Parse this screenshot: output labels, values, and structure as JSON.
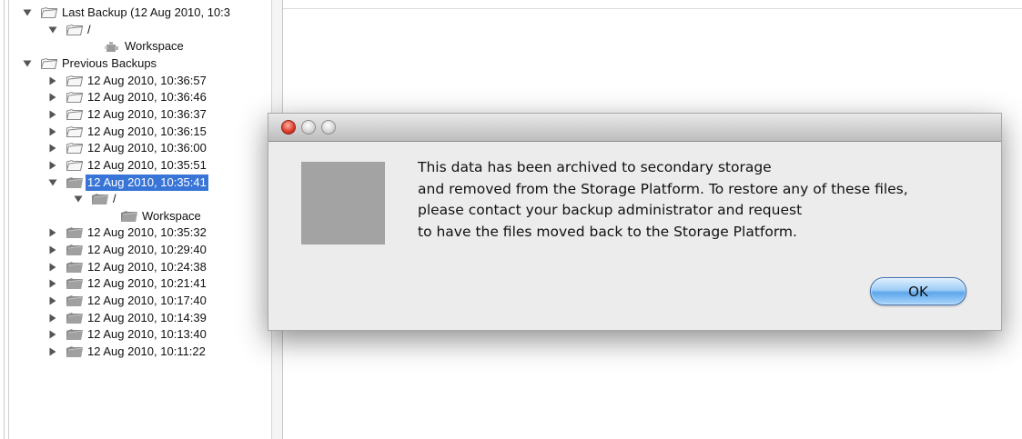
{
  "tree": {
    "nodes": [
      {
        "label": "Last Backup (12 Aug 2010, 10:3",
        "expanded": true,
        "folder": "outline"
      },
      {
        "label": "/",
        "expanded": true,
        "folder": "outline"
      },
      {
        "label": "Workspace",
        "icon": "workspace-puzzle-icon"
      },
      {
        "label": "Previous Backups",
        "expanded": true,
        "folder": "outline"
      },
      {
        "label": "12 Aug 2010, 10:36:57",
        "expanded": false,
        "folder": "outline"
      },
      {
        "label": "12 Aug 2010, 10:36:46",
        "expanded": false,
        "folder": "outline"
      },
      {
        "label": "12 Aug 2010, 10:36:37",
        "expanded": false,
        "folder": "outline"
      },
      {
        "label": "12 Aug 2010, 10:36:15",
        "expanded": false,
        "folder": "outline"
      },
      {
        "label": "12 Aug 2010, 10:36:00",
        "expanded": false,
        "folder": "outline"
      },
      {
        "label": "12 Aug 2010, 10:35:51",
        "expanded": false,
        "folder": "outline"
      },
      {
        "label": "12 Aug 2010, 10:35:41",
        "expanded": true,
        "folder": "gray",
        "selected": true
      },
      {
        "label": "/",
        "expanded": true,
        "folder": "gray"
      },
      {
        "label": "Workspace",
        "folder": "gray"
      },
      {
        "label": "12 Aug 2010, 10:35:32",
        "expanded": false,
        "folder": "gray"
      },
      {
        "label": "12 Aug 2010, 10:29:40",
        "expanded": false,
        "folder": "gray"
      },
      {
        "label": "12 Aug 2010, 10:24:38",
        "expanded": false,
        "folder": "gray"
      },
      {
        "label": "12 Aug 2010, 10:21:41",
        "expanded": false,
        "folder": "gray"
      },
      {
        "label": "12 Aug 2010, 10:17:40",
        "expanded": false,
        "folder": "gray"
      },
      {
        "label": "12 Aug 2010, 10:14:39",
        "expanded": false,
        "folder": "gray"
      },
      {
        "label": "12 Aug 2010, 10:13:40",
        "expanded": false,
        "folder": "gray"
      },
      {
        "label": "12 Aug 2010, 10:11:22",
        "expanded": false,
        "folder": "gray"
      }
    ]
  },
  "dialog": {
    "message_lines": [
      "This data has been archived to secondary storage",
      "and removed from the Storage Platform. To restore any of these files,",
      "please contact your backup administrator and request",
      "to have the files moved back to the Storage Platform."
    ],
    "ok_label": "OK",
    "colors": {
      "selection": "#3875d7",
      "close_button": "#e0402d",
      "ok_button": "#5ea7ea"
    }
  }
}
